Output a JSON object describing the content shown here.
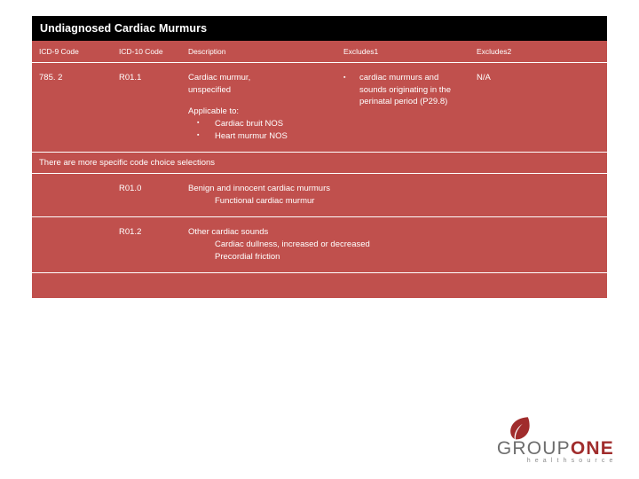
{
  "slide": {
    "title": "Undiagnosed Cardiac Murmurs"
  },
  "table": {
    "headers": {
      "icd9": "ICD-9 Code",
      "icd10": "ICD-10 Code",
      "description": "Description",
      "excludes1": "Excludes1",
      "excludes2": "Excludes2"
    },
    "main_row": {
      "icd9": "785. 2",
      "icd10": "R01.1",
      "description_line1": "Cardiac murmur,",
      "description_line2": "unspecified",
      "applicable_label": "Applicable to:",
      "applicable_items": [
        "Cardiac bruit NOS",
        "Heart murmur NOS"
      ],
      "excludes1": "cardiac murmurs and sounds originating in the perinatal period (P29.8)",
      "excludes2": "N/A"
    },
    "note": "There are more specific code choice selections",
    "sub_rows": [
      {
        "code": "R01.0",
        "title": "Benign and innocent cardiac murmurs",
        "details": [
          "Functional cardiac murmur"
        ]
      },
      {
        "code": "R01.2",
        "title": "Other cardiac sounds",
        "details": [
          "Cardiac dullness, increased or decreased",
          "Precordial friction"
        ]
      }
    ]
  },
  "logo": {
    "word_one": "GROUP",
    "word_two": "ONE",
    "tagline": "h e a l t h s o u r c e"
  },
  "colors": {
    "table_fill": "#c0504d",
    "title_bar": "#000000",
    "logo_accent": "#a02c2c"
  }
}
